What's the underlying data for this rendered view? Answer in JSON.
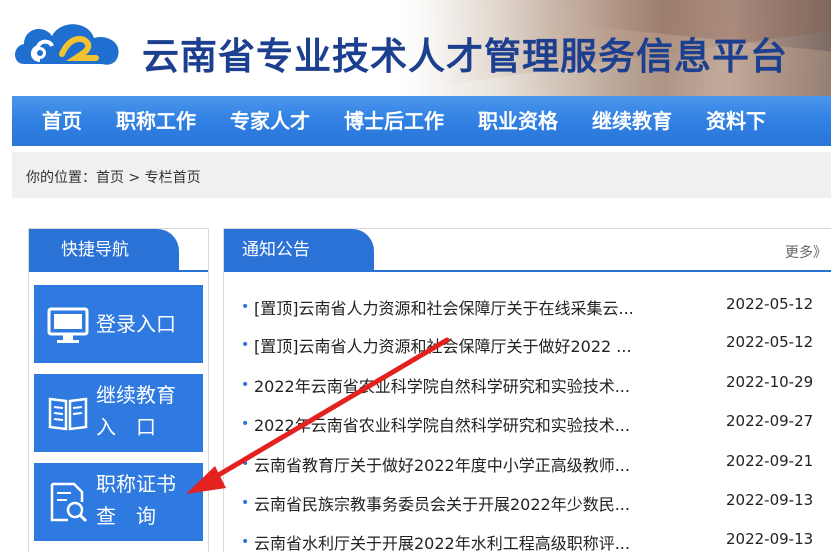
{
  "header": {
    "site_title": "云南省专业技术人才管理服务信息平台"
  },
  "nav": {
    "items": [
      {
        "label": "首页"
      },
      {
        "label": "职称工作"
      },
      {
        "label": "专家人才"
      },
      {
        "label": "博士后工作"
      },
      {
        "label": "职业资格"
      },
      {
        "label": "继续教育"
      },
      {
        "label": "资料下"
      }
    ]
  },
  "breadcrumb": {
    "prefix": "你的位置：",
    "home": "首页",
    "sep": " > ",
    "current": "专栏首页"
  },
  "quick_nav": {
    "title": "快捷导航",
    "buttons": [
      {
        "line1": "登录入口",
        "line2": "",
        "icon": "monitor-icon"
      },
      {
        "line1": "继续教育",
        "line2": "入　口",
        "icon": "book-icon"
      },
      {
        "line1": "职称证书",
        "line2": "查　询",
        "icon": "document-search-icon"
      }
    ]
  },
  "notices": {
    "title": "通知公告",
    "more": "更多》",
    "items": [
      {
        "title": "[置顶]云南省人力资源和社会保障厅关于在线采集云...",
        "date": "2022-05-12"
      },
      {
        "title": "[置顶]云南省人力资源和社会保障厅关于做好2022 ...",
        "date": "2022-05-12"
      },
      {
        "title": "2022年云南省农业科学院自然科学研究和实验技术...",
        "date": "2022-10-29"
      },
      {
        "title": "2022年云南省农业科学院自然科学研究和实验技术...",
        "date": "2022-09-27"
      },
      {
        "title": "云南省教育厅关于做好2022年度中小学正高级教师...",
        "date": "2022-09-21"
      },
      {
        "title": "云南省民族宗教事务委员会关于开展2022年少数民...",
        "date": "2022-09-13"
      },
      {
        "title": "云南省水利厅关于开展2022年水利工程高级职称评...",
        "date": "2022-09-13"
      }
    ]
  },
  "colors": {
    "primary_blue": "#2a72d6",
    "title_blue": "#1d3f8f",
    "annotation_red": "#e3211f"
  }
}
